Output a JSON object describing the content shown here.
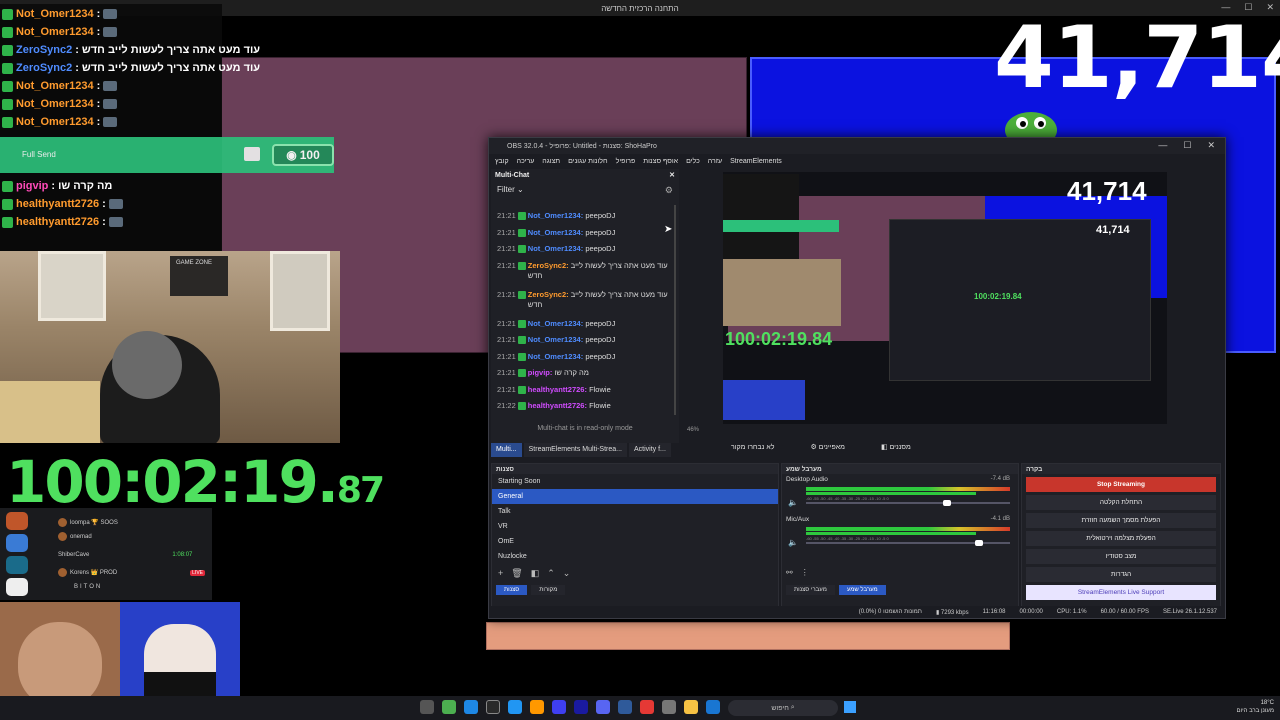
{
  "topbar": {
    "title": "התחנה הרכזית החדשה"
  },
  "overlay": {
    "counter": "41,714",
    "chat": [
      {
        "user": "Not_Omer1234",
        "sep": ":",
        "text": "",
        "color": "orange"
      },
      {
        "user": "Not_Omer1234",
        "sep": ":",
        "text": "",
        "color": "orange"
      },
      {
        "user": "ZeroSync2",
        "sep": ":",
        "text": "עוד מעט אתה צריך לעשות לייב חדש",
        "color": "blue"
      },
      {
        "user": "ZeroSync2",
        "sep": ":",
        "text": "עוד מעט אתה צריך לעשות לייב חדש",
        "color": "blue"
      },
      {
        "user": "Not_Omer1234",
        "sep": ":",
        "text": "",
        "color": "orange"
      },
      {
        "user": "Not_Omer1234",
        "sep": ":",
        "text": "",
        "color": "orange"
      },
      {
        "user": "Not_Omer1234",
        "sep": ":",
        "text": "",
        "color": "orange"
      },
      {
        "user": "pigvip",
        "sep": ":",
        "text": "מה קרה שו",
        "color": "pink"
      },
      {
        "user": "healthyantt2726",
        "sep": ":",
        "text": "",
        "color": "orange"
      },
      {
        "user": "healthyantt2726",
        "sep": ":",
        "text": "",
        "color": "orange"
      }
    ],
    "send_text": "Full Send",
    "send_amount": "100",
    "poster_text": "GAME ZONE",
    "timer_main": "100:02:19.",
    "timer_frac": "87",
    "discord": {
      "rows": [
        "loompa 🏆 SOOS",
        "onemad",
        "ShiberCave",
        "Korens 👑 PROD",
        "BITON"
      ],
      "time": "1:08:07",
      "live": "LIVE"
    }
  },
  "obs": {
    "title": "OBS 32.0.4 - פרופיל: Untitled - סצנות: ShoHaPro",
    "menu": [
      "קובץ",
      "עריכה",
      "תצוגה",
      "חלונות עגונים",
      "פרופיל",
      "אוסף סצנות",
      "כלים",
      "עזרה",
      "StreamElements"
    ],
    "multichat": {
      "title": "Multi-Chat",
      "filter": "Filter",
      "messages": [
        {
          "ts": "21:21",
          "user": "Not_Omer1234:",
          "text": "peepoDJ",
          "cls": "u1"
        },
        {
          "ts": "21:21",
          "user": "Not_Omer1234:",
          "text": "peepoDJ",
          "cls": "u1"
        },
        {
          "ts": "21:21",
          "user": "Not_Omer1234:",
          "text": "peepoDJ",
          "cls": "u1"
        },
        {
          "ts": "21:21",
          "user": "ZeroSync2:",
          "text": "עוד מעט אתה צריך לעשות לייב חדש",
          "cls": "u2"
        },
        {
          "ts": "21:21",
          "user": "ZeroSync2:",
          "text": "עוד מעט אתה צריך לעשות לייב חדש",
          "cls": "u2"
        },
        {
          "ts": "21:21",
          "user": "Not_Omer1234:",
          "text": "peepoDJ",
          "cls": "u1"
        },
        {
          "ts": "21:21",
          "user": "Not_Omer1234:",
          "text": "peepoDJ",
          "cls": "u1"
        },
        {
          "ts": "21:21",
          "user": "Not_Omer1234:",
          "text": "peepoDJ",
          "cls": "u1"
        },
        {
          "ts": "21:21",
          "user": "pigvip:",
          "text": "מה קרה שו",
          "cls": "u3"
        },
        {
          "ts": "21:21",
          "user": "healthyantt2726:",
          "text": "Flowie",
          "cls": "u3"
        },
        {
          "ts": "21:22",
          "user": "healthyantt2726:",
          "text": "Flowie",
          "cls": "u3"
        }
      ],
      "readonly": "Multi-chat is in read-only mode"
    },
    "dock_tabs": [
      "Multi...",
      "StreamElements Multi-Strea...",
      "Activity f..."
    ],
    "preview": {
      "counter": "41,714",
      "timer": "100:02:19.84",
      "inner_counter": "41,714",
      "inner_timer": "100:02:19.84",
      "zoom": "46%"
    },
    "mode_labels": [
      "לא נבחרו מקור",
      "מאפיינים",
      "מסננים"
    ],
    "scenes": {
      "title": "סצנות",
      "items": [
        "Starting Soon",
        "General",
        "Talk",
        "VR",
        "OmE",
        "Nuzlocke"
      ],
      "selected": 1,
      "tabs": [
        "סצנות",
        "מקורות"
      ]
    },
    "mixer": {
      "title": "מערבל שמע",
      "channels": [
        {
          "name": "Desktop Audio",
          "db": "-7.4 dB",
          "fader": 0.7
        },
        {
          "name": "Mic/Aux",
          "db": "-4.1 dB",
          "fader": 0.86
        }
      ],
      "ticks": "-60 -55 -50 -45 -40 -35 -30 -25 -20 -15 -10 -5 0",
      "tabs": [
        "מעברי סצנות",
        "מערבל שמע"
      ]
    },
    "controls": {
      "title": "בקרה",
      "buttons": [
        "Stop Streaming",
        "התחלת הקלטה",
        "הפעלת מסמך השמעה חוזרת",
        "הפעלת מצלמה וירטואלית",
        "מצב סטודיו",
        "הגדרות",
        "StreamElements Live Support"
      ]
    },
    "status": {
      "dropped": "(0.0%) 0 תמונות הושמטו",
      "kbps": "7293 kbps",
      "stream_time": "11:16:08",
      "rec_time": "00:00:00",
      "cpu": "CPU: 1.1%",
      "fps": "60.00 / 60.00 FPS",
      "version": "SE.Live 26.1.12.537"
    }
  },
  "taskbar": {
    "search": "חיפוש",
    "weather": "18°C",
    "time": "מעונן ברב היום"
  },
  "colors": {
    "accent": "#2b59c3",
    "stop": "#c8362c",
    "timer": "#4fe05f",
    "blue_bg": "#0b12e0",
    "pink_bg": "#6a3f58"
  }
}
